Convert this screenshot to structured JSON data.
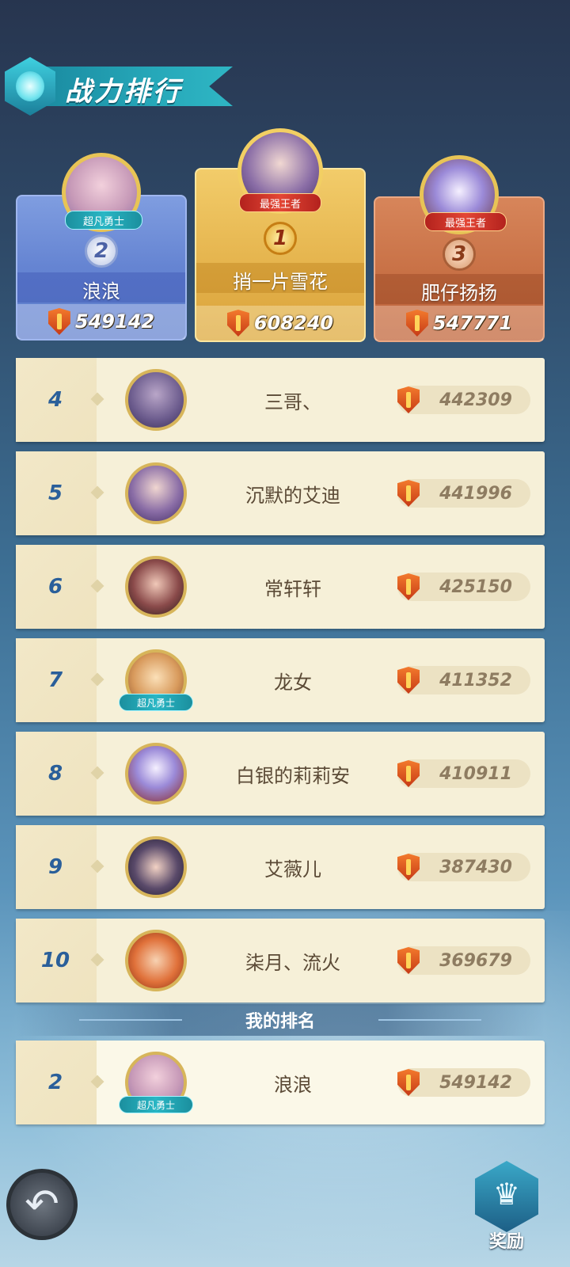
{
  "header": {
    "title": "战力排行"
  },
  "podium": {
    "first": {
      "rank": "1",
      "badge": "最强王者",
      "name": "捎一片雪花",
      "power": "608240"
    },
    "second": {
      "rank": "2",
      "badge": "超凡勇士",
      "name": "浪浪",
      "power": "549142"
    },
    "third": {
      "rank": "3",
      "badge": "最强王者",
      "name": "肥仔扬扬",
      "power": "547771"
    }
  },
  "ranking": [
    {
      "rank": "4",
      "name": "三哥、",
      "power": "442309"
    },
    {
      "rank": "5",
      "name": "沉默的艾迪",
      "power": "441996"
    },
    {
      "rank": "6",
      "name": "常轩轩",
      "power": "425150"
    },
    {
      "rank": "7",
      "name": "龙女",
      "power": "411352",
      "badge": "超凡勇士"
    },
    {
      "rank": "8",
      "name": "白银的莉莉安",
      "power": "410911"
    },
    {
      "rank": "9",
      "name": "艾薇儿",
      "power": "387430"
    },
    {
      "rank": "10",
      "name": "柒月、流火",
      "power": "369679"
    }
  ],
  "my_rank": {
    "section_title": "我的排名",
    "rank": "2",
    "name": "浪浪",
    "power": "549142",
    "badge": "超凡勇士"
  },
  "footer": {
    "reward_label": "奖励"
  },
  "colors": {
    "first": "#e4b24b",
    "second": "#6584d2",
    "third": "#c66e43",
    "row": "#f6f0d8",
    "rank_number": "#2a5f9a"
  },
  "icons": [
    "back-arrow-icon",
    "reward-crown-icon",
    "power-shield-icon",
    "ranking-emblem-icon"
  ]
}
